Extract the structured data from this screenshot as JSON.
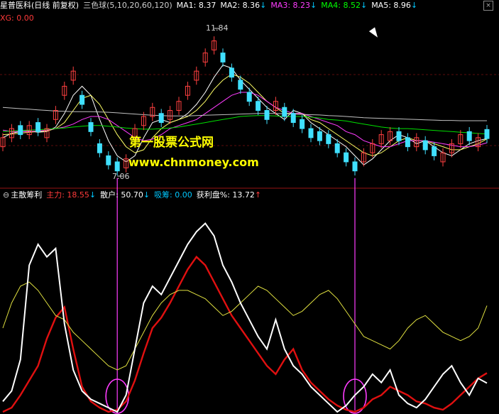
{
  "header": {
    "stock_name": "星普医科",
    "period": "(日线 前复权)",
    "indicator": "三色球(5,10,20,60,120)",
    "ma1": "MA1: 8.37",
    "ma2": "MA2: 8.36",
    "ma3": "MA3: 8.23",
    "ma4": "MA4: 8.52",
    "ma5": "MA5: 8.96",
    "xg": "XG: 0.00",
    "down_arrow": "↓"
  },
  "annotations": {
    "high": "11.84",
    "low": "7.06"
  },
  "watermark": {
    "line1": "第一股票公式网",
    "line2": "www.chnmoney.com"
  },
  "indicator": {
    "name": "主散筹利",
    "zhuli": "主力: 18.55",
    "sanhu": "散户: 50.70",
    "xichou": "吸筹: 0.00",
    "huoli": "获利盘%: 13.72",
    "up_arrow": "↑",
    "down_arrow": "↓"
  },
  "colors": {
    "background": "#000000",
    "candle_up": "#ff4040",
    "candle_down": "#40e0ff",
    "ma1": "#ffffff",
    "ma2": "#ffff66",
    "ma3": "#ff3cff",
    "ma4": "#00e000",
    "ma5": "#c0c0c0",
    "zhuli": "#e01010",
    "sanhu": "#e0e040",
    "white_line": "#ffffff",
    "marker": "#ff3cff",
    "grid": "#7a1010"
  },
  "chart_data": [
    {
      "type": "line",
      "title": "三色球(5,10,20,60,120)",
      "series": [
        {
          "name": "MA1",
          "values": [
            8.4,
            8.55,
            8.6,
            8.62,
            8.58,
            8.6,
            8.75,
            9.2,
            9.8,
            10.1,
            9.8,
            9.0,
            8.3,
            7.8,
            7.6,
            7.8,
            8.4,
            8.9,
            9.0,
            8.9,
            9.0,
            9.2,
            9.5,
            9.9,
            10.4,
            10.8,
            10.7,
            10.3,
            10.0,
            9.7,
            9.4,
            9.2,
            9.0,
            9.3,
            9.2,
            8.9,
            8.7,
            8.5,
            8.3,
            8.1,
            7.8,
            7.5,
            7.7,
            8.0,
            8.3,
            8.5,
            8.4,
            8.2,
            8.3,
            8.1,
            7.9,
            7.8,
            8.0,
            8.2,
            8.3,
            8.37
          ]
        },
        {
          "name": "MA2",
          "values": [
            8.5,
            8.52,
            8.55,
            8.58,
            8.6,
            8.62,
            8.7,
            8.9,
            9.3,
            9.7,
            9.8,
            9.5,
            9.0,
            8.5,
            8.1,
            7.9,
            8.0,
            8.4,
            8.7,
            8.9,
            9.0,
            9.1,
            9.3,
            9.6,
            10.0,
            10.3,
            10.5,
            10.4,
            10.2,
            9.9,
            9.6,
            9.4,
            9.2,
            9.2,
            9.2,
            9.0,
            8.9,
            8.7,
            8.5,
            8.3,
            8.1,
            7.9,
            7.8,
            7.9,
            8.1,
            8.3,
            8.4,
            8.3,
            8.3,
            8.2,
            8.1,
            8.0,
            8.0,
            8.1,
            8.2,
            8.36
          ]
        },
        {
          "name": "MA3",
          "values": [
            8.65,
            8.6,
            8.6,
            8.6,
            8.62,
            8.65,
            8.7,
            8.75,
            8.85,
            9.0,
            9.1,
            9.1,
            9.0,
            8.8,
            8.6,
            8.4,
            8.3,
            8.35,
            8.5,
            8.7,
            8.8,
            8.9,
            9.0,
            9.2,
            9.4,
            9.6,
            9.8,
            9.9,
            9.9,
            9.8,
            9.6,
            9.4,
            9.3,
            9.2,
            9.2,
            9.1,
            9.0,
            8.9,
            8.8,
            8.6,
            8.5,
            8.3,
            8.2,
            8.1,
            8.1,
            8.2,
            8.3,
            8.3,
            8.3,
            8.25,
            8.2,
            8.15,
            8.1,
            8.1,
            8.15,
            8.23
          ]
        },
        {
          "name": "MA4",
          "values": [
            8.6,
            8.62,
            8.64,
            8.65,
            8.66,
            8.68,
            8.7,
            8.72,
            8.75,
            8.78,
            8.8,
            8.8,
            8.78,
            8.75,
            8.72,
            8.7,
            8.68,
            8.68,
            8.7,
            8.72,
            8.75,
            8.8,
            8.85,
            8.9,
            8.95,
            9.0,
            9.05,
            9.1,
            9.12,
            9.13,
            9.13,
            9.12,
            9.1,
            9.1,
            9.1,
            9.08,
            9.05,
            9.0,
            8.98,
            8.95,
            8.9,
            8.85,
            8.8,
            8.75,
            8.72,
            8.7,
            8.7,
            8.68,
            8.66,
            8.64,
            8.62,
            8.6,
            8.58,
            8.56,
            8.54,
            8.52
          ]
        },
        {
          "name": "MA5",
          "values": [
            9.4,
            9.38,
            9.36,
            9.34,
            9.32,
            9.3,
            9.28,
            9.27,
            9.26,
            9.26,
            9.26,
            9.25,
            9.24,
            9.22,
            9.2,
            9.18,
            9.16,
            9.14,
            9.13,
            9.12,
            9.12,
            9.12,
            9.13,
            9.14,
            9.15,
            9.16,
            9.17,
            9.18,
            9.19,
            9.2,
            9.2,
            9.2,
            9.19,
            9.18,
            9.17,
            9.16,
            9.15,
            9.13,
            9.12,
            9.1,
            9.08,
            9.06,
            9.05,
            9.04,
            9.03,
            9.02,
            9.01,
            9.0,
            8.99,
            8.98,
            8.97,
            8.97,
            8.96,
            8.96,
            8.96,
            8.96
          ]
        }
      ],
      "candles_close": [
        8.4,
        8.7,
        8.5,
        8.8,
        8.6,
        8.7,
        9.3,
        10.1,
        10.6,
        9.5,
        8.6,
        7.9,
        7.5,
        7.3,
        7.7,
        8.7,
        9.1,
        9.4,
        8.9,
        9.3,
        9.6,
        10.1,
        10.6,
        11.2,
        11.6,
        10.9,
        10.4,
        10.0,
        9.6,
        9.3,
        9.0,
        9.6,
        9.1,
        8.9,
        8.7,
        8.4,
        8.3,
        8.2,
        7.9,
        7.6,
        7.3,
        7.9,
        8.2,
        8.5,
        8.6,
        8.3,
        8.1,
        8.4,
        8.0,
        7.8,
        7.9,
        8.2,
        8.5,
        8.3,
        8.4,
        8.37
      ],
      "candles_up": [
        true,
        true,
        false,
        true,
        false,
        true,
        true,
        true,
        true,
        false,
        false,
        false,
        false,
        false,
        true,
        true,
        true,
        true,
        false,
        true,
        true,
        true,
        true,
        true,
        true,
        false,
        false,
        false,
        false,
        false,
        false,
        true,
        false,
        false,
        false,
        false,
        false,
        false,
        false,
        false,
        false,
        true,
        true,
        true,
        true,
        false,
        false,
        true,
        false,
        false,
        true,
        true,
        true,
        false,
        true,
        false
      ],
      "high_label": 11.84,
      "low_label": 7.06
    },
    {
      "type": "line",
      "title": "主散筹利",
      "series": [
        {
          "name": "主力",
          "values": [
            0,
            2,
            8,
            15,
            22,
            35,
            45,
            50,
            30,
            12,
            5,
            2,
            0,
            1,
            5,
            15,
            28,
            40,
            45,
            52,
            60,
            68,
            74,
            70,
            62,
            54,
            46,
            40,
            34,
            28,
            22,
            18,
            25,
            30,
            20,
            14,
            10,
            6,
            3,
            1,
            0,
            2,
            6,
            8,
            12,
            10,
            8,
            5,
            4,
            2,
            1,
            4,
            8,
            12,
            16,
            18.55
          ]
        },
        {
          "name": "散户",
          "values": [
            40,
            52,
            60,
            62,
            58,
            52,
            46,
            44,
            38,
            34,
            30,
            26,
            22,
            20,
            22,
            30,
            38,
            46,
            52,
            56,
            58,
            58,
            56,
            54,
            50,
            46,
            48,
            52,
            56,
            60,
            58,
            54,
            50,
            46,
            48,
            52,
            56,
            58,
            54,
            48,
            42,
            36,
            34,
            32,
            30,
            34,
            40,
            44,
            46,
            42,
            38,
            36,
            34,
            36,
            40,
            50.7
          ]
        },
        {
          "name": "获利盘%",
          "values": [
            5,
            10,
            25,
            70,
            80,
            74,
            78,
            42,
            20,
            10,
            6,
            4,
            2,
            0,
            8,
            30,
            52,
            60,
            56,
            64,
            72,
            80,
            86,
            90,
            84,
            70,
            62,
            52,
            44,
            36,
            30,
            44,
            30,
            22,
            18,
            12,
            8,
            4,
            0,
            3,
            8,
            12,
            18,
            14,
            20,
            8,
            4,
            2,
            6,
            12,
            18,
            22,
            14,
            8,
            16,
            13.72
          ]
        }
      ]
    }
  ]
}
